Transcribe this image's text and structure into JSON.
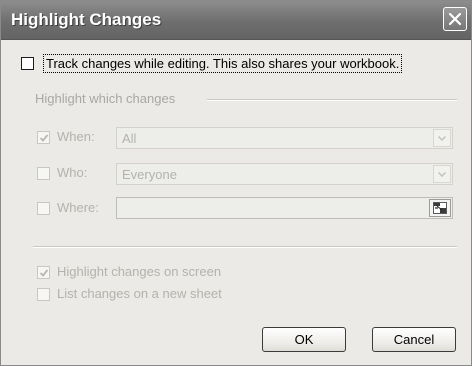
{
  "dialog": {
    "title": "Highlight Changes",
    "close_icon": "close-icon"
  },
  "track": {
    "label": "Track changes while editing. This also shares your workbook.",
    "checked": false
  },
  "group": {
    "label": "Highlight which changes"
  },
  "when": {
    "label": "When:",
    "value": "All",
    "checked": true
  },
  "who": {
    "label": "Who:",
    "value": "Everyone",
    "checked": false
  },
  "where": {
    "label": "Where:",
    "value": "",
    "checked": false,
    "icon": "range-selector-icon"
  },
  "options": {
    "highlight_on_screen": {
      "label": "Highlight changes on screen",
      "checked": true
    },
    "list_on_new_sheet": {
      "label": "List changes on a new sheet",
      "checked": false
    }
  },
  "buttons": {
    "ok": "OK",
    "cancel": "Cancel"
  }
}
